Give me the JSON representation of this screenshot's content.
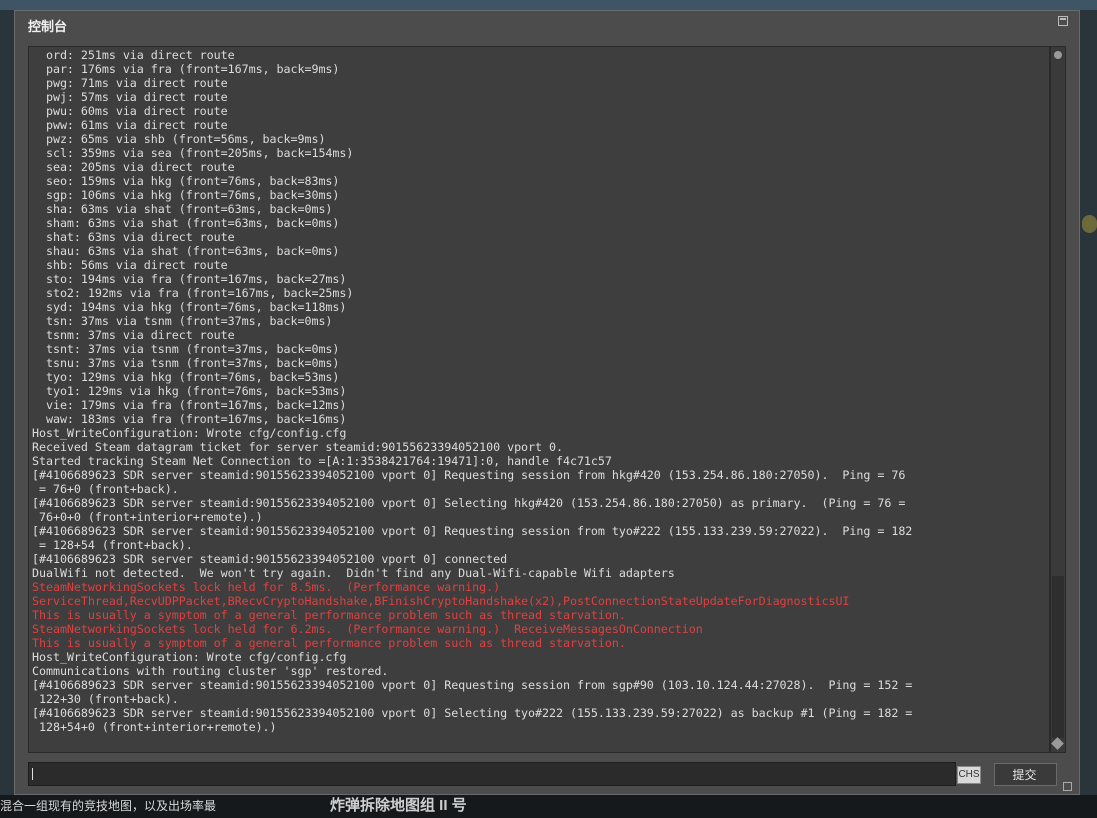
{
  "window": {
    "title": "控制台",
    "submit_label": "提交",
    "ime_label": "CHS",
    "input_value": ""
  },
  "background": {
    "left_text": "混合一组现有的竞技地图，以及出场率最",
    "center_text": "炸弹拆除地图组 II 号"
  },
  "console": {
    "lines": [
      {
        "text": "  ord: 251ms via direct route",
        "type": "normal"
      },
      {
        "text": "  par: 176ms via fra (front=167ms, back=9ms)",
        "type": "normal"
      },
      {
        "text": "  pwg: 71ms via direct route",
        "type": "normal"
      },
      {
        "text": "  pwj: 57ms via direct route",
        "type": "normal"
      },
      {
        "text": "  pwu: 60ms via direct route",
        "type": "normal"
      },
      {
        "text": "  pww: 61ms via direct route",
        "type": "normal"
      },
      {
        "text": "  pwz: 65ms via shb (front=56ms, back=9ms)",
        "type": "normal"
      },
      {
        "text": "  scl: 359ms via sea (front=205ms, back=154ms)",
        "type": "normal"
      },
      {
        "text": "  sea: 205ms via direct route",
        "type": "normal"
      },
      {
        "text": "  seo: 159ms via hkg (front=76ms, back=83ms)",
        "type": "normal"
      },
      {
        "text": "  sgp: 106ms via hkg (front=76ms, back=30ms)",
        "type": "normal"
      },
      {
        "text": "  sha: 63ms via shat (front=63ms, back=0ms)",
        "type": "normal"
      },
      {
        "text": "  sham: 63ms via shat (front=63ms, back=0ms)",
        "type": "normal"
      },
      {
        "text": "  shat: 63ms via direct route",
        "type": "normal"
      },
      {
        "text": "  shau: 63ms via shat (front=63ms, back=0ms)",
        "type": "normal"
      },
      {
        "text": "  shb: 56ms via direct route",
        "type": "normal"
      },
      {
        "text": "  sto: 194ms via fra (front=167ms, back=27ms)",
        "type": "normal"
      },
      {
        "text": "  sto2: 192ms via fra (front=167ms, back=25ms)",
        "type": "normal"
      },
      {
        "text": "  syd: 194ms via hkg (front=76ms, back=118ms)",
        "type": "normal"
      },
      {
        "text": "  tsn: 37ms via tsnm (front=37ms, back=0ms)",
        "type": "normal"
      },
      {
        "text": "  tsnm: 37ms via direct route",
        "type": "normal"
      },
      {
        "text": "  tsnt: 37ms via tsnm (front=37ms, back=0ms)",
        "type": "normal"
      },
      {
        "text": "  tsnu: 37ms via tsnm (front=37ms, back=0ms)",
        "type": "normal"
      },
      {
        "text": "  tyo: 129ms via hkg (front=76ms, back=53ms)",
        "type": "normal"
      },
      {
        "text": "  tyo1: 129ms via hkg (front=76ms, back=53ms)",
        "type": "normal"
      },
      {
        "text": "  vie: 179ms via fra (front=167ms, back=12ms)",
        "type": "normal"
      },
      {
        "text": "  waw: 183ms via fra (front=167ms, back=16ms)",
        "type": "normal"
      },
      {
        "text": "Host_WriteConfiguration: Wrote cfg/config.cfg",
        "type": "normal"
      },
      {
        "text": "Received Steam datagram ticket for server steamid:90155623394052100 vport 0.",
        "type": "normal"
      },
      {
        "text": "Started tracking Steam Net Connection to =[A:1:3538421764:19471]:0, handle f4c71c57",
        "type": "normal"
      },
      {
        "text": "[#4106689623 SDR server steamid:90155623394052100 vport 0] Requesting session from hkg#420 (153.254.86.180:27050).  Ping = 76",
        "type": "normal"
      },
      {
        "text": " = 76+0 (front+back).",
        "type": "normal"
      },
      {
        "text": "[#4106689623 SDR server steamid:90155623394052100 vport 0] Selecting hkg#420 (153.254.86.180:27050) as primary.  (Ping = 76 =",
        "type": "normal"
      },
      {
        "text": " 76+0+0 (front+interior+remote).)",
        "type": "normal"
      },
      {
        "text": "[#4106689623 SDR server steamid:90155623394052100 vport 0] Requesting session from tyo#222 (155.133.239.59:27022).  Ping = 182",
        "type": "normal"
      },
      {
        "text": " = 128+54 (front+back).",
        "type": "normal"
      },
      {
        "text": "[#4106689623 SDR server steamid:90155623394052100 vport 0] connected",
        "type": "normal"
      },
      {
        "text": "DualWifi not detected.  We won't try again.  Didn't find any Dual-Wifi-capable Wifi adapters",
        "type": "normal"
      },
      {
        "text": "SteamNetworkingSockets lock held for 8.5ms.  (Performance warning.)",
        "type": "warning"
      },
      {
        "text": "ServiceThread,RecvUDPPacket,BRecvCryptoHandshake,BFinishCryptoHandshake(x2),PostConnectionStateUpdateForDiagnosticsUI",
        "type": "warning"
      },
      {
        "text": "This is usually a symptom of a general performance problem such as thread starvation.",
        "type": "warning"
      },
      {
        "text": "SteamNetworkingSockets lock held for 6.2ms.  (Performance warning.)  ReceiveMessagesOnConnection",
        "type": "warning"
      },
      {
        "text": "This is usually a symptom of a general performance problem such as thread starvation.",
        "type": "warning"
      },
      {
        "text": "Host_WriteConfiguration: Wrote cfg/config.cfg",
        "type": "normal"
      },
      {
        "text": "Communications with routing cluster 'sgp' restored.",
        "type": "normal"
      },
      {
        "text": "[#4106689623 SDR server steamid:90155623394052100 vport 0] Requesting session from sgp#90 (103.10.124.44:27028).  Ping = 152 =",
        "type": "normal"
      },
      {
        "text": " 122+30 (front+back).",
        "type": "normal"
      },
      {
        "text": "[#4106689623 SDR server steamid:90155623394052100 vport 0] Selecting tyo#222 (155.133.239.59:27022) as backup #1 (Ping = 182 =",
        "type": "normal"
      },
      {
        "text": " 128+54+0 (front+interior+remote).)",
        "type": "normal"
      }
    ]
  },
  "scrollbar": {
    "thumb_start_fraction": 0.76,
    "thumb_end_fraction": 1.0
  },
  "colors": {
    "normal_text": "#dcdcdc",
    "warning_text": "#e04040",
    "console_bg": "#3e3e3e",
    "window_bg": "#4c4c4c"
  }
}
